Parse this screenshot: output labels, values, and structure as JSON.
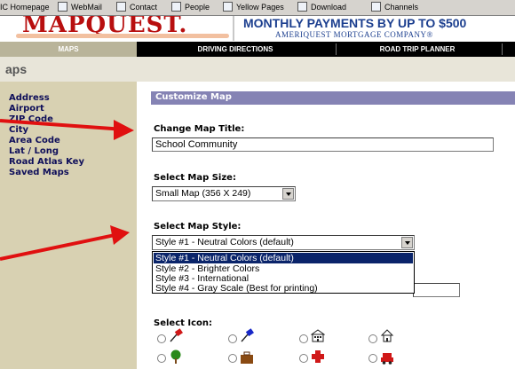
{
  "links_bar": {
    "items": [
      {
        "label": "IC Homepage"
      },
      {
        "label": "WebMail"
      },
      {
        "label": "Contact"
      },
      {
        "label": "People"
      },
      {
        "label": "Yellow Pages"
      },
      {
        "label": "Download"
      },
      {
        "label": "Channels"
      }
    ]
  },
  "brand": {
    "logo_text": "MAPQUEST."
  },
  "ad": {
    "headline": "MONTHLY PAYMENTS BY UP TO $500",
    "sub": "AMERIQUEST MORTGAGE COMPANY®"
  },
  "nav": {
    "items": [
      {
        "label": "MAPS"
      },
      {
        "label": "DRIVING DIRECTIONS"
      },
      {
        "label": "ROAD TRIP PLANNER"
      }
    ]
  },
  "section_title": "aps",
  "sidebar": {
    "items": [
      {
        "label": "Address"
      },
      {
        "label": "Airport"
      },
      {
        "label": "ZIP Code"
      },
      {
        "label": "City"
      },
      {
        "label": "Area Code"
      },
      {
        "label": "Lat / Long"
      },
      {
        "label": "Road Atlas Key"
      },
      {
        "label": "Saved Maps"
      }
    ]
  },
  "customize": {
    "header": "Customize Map",
    "title_label": "Change Map Title:",
    "title_value": "School Community",
    "size_label": "Select Map Size:",
    "size_value": "Small Map (356 X 249)",
    "style_label": "Select Map Style:",
    "style_value": "Style #1 - Neutral Colors (default)",
    "style_options": [
      {
        "label": "Style #1 - Neutral Colors (default)",
        "selected": true
      },
      {
        "label": "Style #2 - Brighter Colors",
        "selected": false
      },
      {
        "label": "Style #3 - International",
        "selected": false
      },
      {
        "label": "Style #4 - Gray Scale (Best for printing)",
        "selected": false
      }
    ],
    "icon_label": "Select Icon:",
    "icons": [
      {
        "name": "red-pushpin-icon"
      },
      {
        "name": "blue-pushpin-icon"
      },
      {
        "name": "building-icon"
      },
      {
        "name": "house-icon"
      },
      {
        "name": "tree-icon"
      },
      {
        "name": "briefcase-icon"
      },
      {
        "name": "red-cross-icon"
      },
      {
        "name": "car-icon"
      }
    ]
  },
  "colors": {
    "sidebar_bg": "#d8d1b2",
    "panel_header": "#8583b4",
    "annotation_arrow": "#e01010",
    "selection": "#0a246a"
  }
}
